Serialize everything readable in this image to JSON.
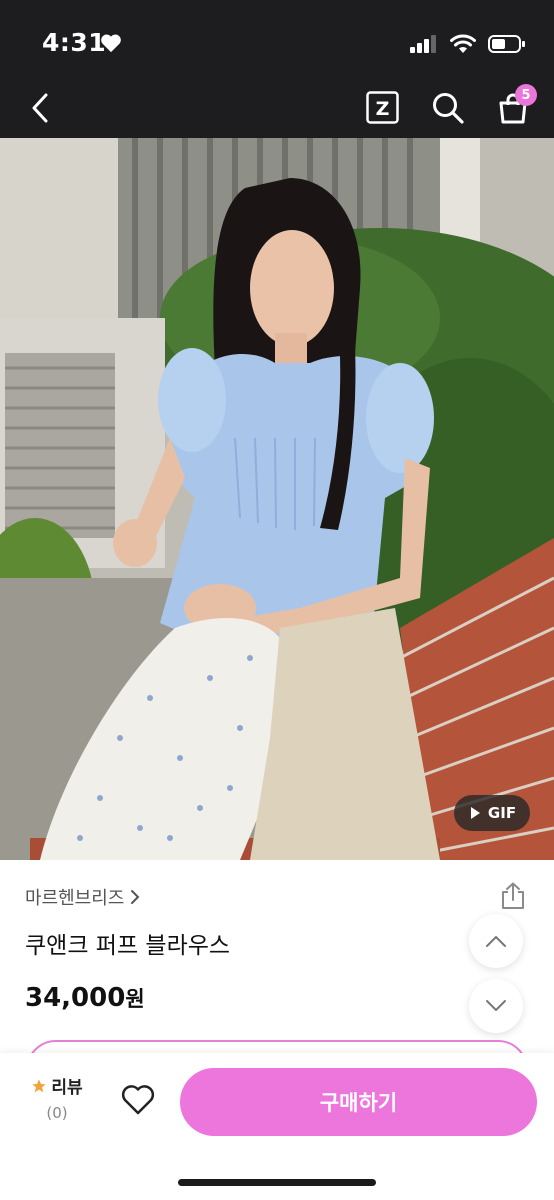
{
  "status_bar": {
    "time": "4:31"
  },
  "nav": {
    "cart_count": "5",
    "z_label": "Z"
  },
  "media": {
    "gif_label": "GIF"
  },
  "product": {
    "brand": "마르헨브리즈",
    "name": "쿠앤크 퍼프 블라우스",
    "price": "34,000",
    "price_unit": "원"
  },
  "bottom": {
    "review_label": "리뷰",
    "review_count": "(0)",
    "buy_label": "구매하기"
  },
  "colors": {
    "accent": "#ec76dc",
    "badge": "#e976d8",
    "topbar": "#1d1d1f"
  }
}
